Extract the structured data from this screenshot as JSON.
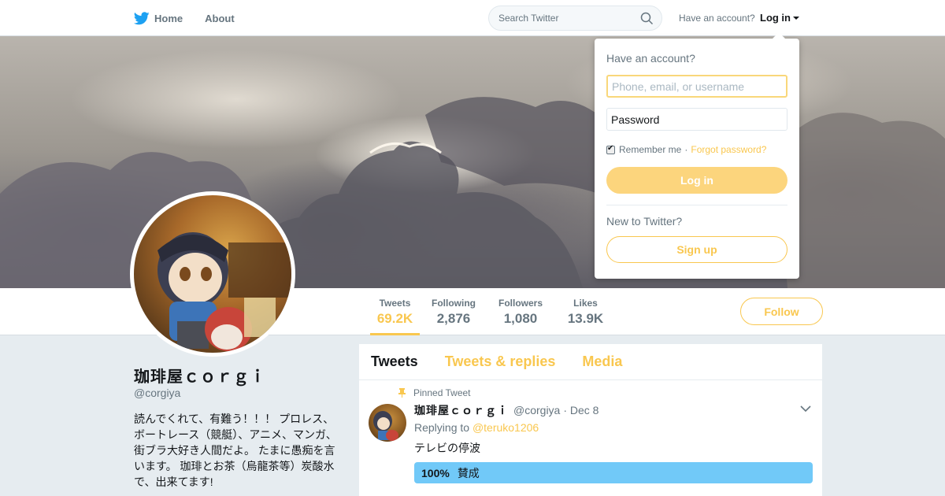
{
  "topbar": {
    "home_label": "Home",
    "about_label": "About",
    "search_placeholder": "Search Twitter",
    "have_account": "Have an account?",
    "login_label": "Log in"
  },
  "profile": {
    "name": "珈琲屋ｃｏｒｇｉ",
    "handle": "@corgiya",
    "bio": "読んでくれて、有難う！！！ プロレス、ボートレース（競艇）、アニメ、マンガ、街ブラ大好き人間だよ。 たまに愚痴を言います。 珈琲とお茶（烏龍茶等）炭酸水で、出来てます!",
    "stats": [
      {
        "label": "Tweets",
        "value": "69.2K"
      },
      {
        "label": "Following",
        "value": "2,876"
      },
      {
        "label": "Followers",
        "value": "1,080"
      },
      {
        "label": "Likes",
        "value": "13.9K"
      }
    ],
    "follow_label": "Follow"
  },
  "timeline": {
    "tabs": [
      "Tweets",
      "Tweets & replies",
      "Media"
    ],
    "pinned_label": "Pinned Tweet",
    "tweet": {
      "name": "珈琲屋ｃｏｒｇｉ",
      "handle": "@corgiya",
      "time": "· Dec 8",
      "replying_prefix": "Replying to",
      "replying_to": "@teruko1206",
      "text": "テレビの停波",
      "poll": {
        "percent_label": "100%",
        "option": "賛成",
        "fraction": 1.0
      }
    }
  },
  "login_dropdown": {
    "title": "Have an account?",
    "username_placeholder": "Phone, email, or username",
    "password_placeholder": "Password",
    "remember_label": "Remember me",
    "separator": "·",
    "forgot_label": "Forgot password?",
    "login_button": "Log in",
    "new_label": "New to Twitter?",
    "signup_button": "Sign up"
  },
  "colors": {
    "accent": "#f9c74f",
    "poll": "#71c9f8",
    "background": "#e6ecf0",
    "twitter_blue": "#1da1f2"
  }
}
